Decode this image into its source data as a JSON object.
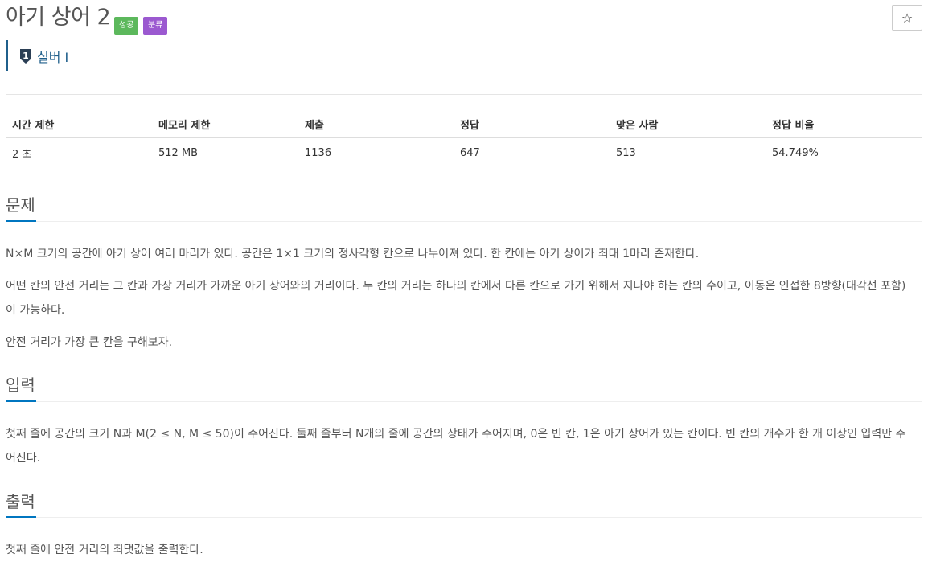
{
  "problem": {
    "title": "아기 상어 2",
    "badges": {
      "success": "성공",
      "category": "분류"
    },
    "star_icon": "☆",
    "tier": {
      "icon": "silver-tier-icon",
      "label": "실버 I"
    }
  },
  "stats": {
    "headers": [
      "시간 제한",
      "메모리 제한",
      "제출",
      "정답",
      "맞은 사람",
      "정답 비율"
    ],
    "values": [
      "2 초",
      "512 MB",
      "1136",
      "647",
      "513",
      "54.749%"
    ]
  },
  "sections": {
    "problem": {
      "title": "문제",
      "paragraphs": [
        "N×M 크기의 공간에 아기 상어 여러 마리가 있다. 공간은 1×1 크기의 정사각형 칸으로 나누어져 있다. 한 칸에는 아기 상어가 최대 1마리 존재한다.",
        "어떤 칸의 안전 거리는 그 칸과 가장 거리가 가까운 아기 상어와의 거리이다. 두 칸의 거리는 하나의 칸에서 다른 칸으로 가기 위해서 지나야 하는 칸의 수이고, 이동은 인접한 8방향(대각선 포함)이 가능하다.",
        "안전 거리가 가장 큰 칸을 구해보자."
      ]
    },
    "input": {
      "title": "입력",
      "paragraphs": [
        "첫째 줄에 공간의 크기 N과 M(2 ≤ N, M ≤ 50)이 주어진다. 둘째 줄부터 N개의 줄에 공간의 상태가 주어지며, 0은 빈 칸, 1은 아기 상어가 있는 칸이다. 빈 칸의 개수가 한 개 이상인 입력만 주어진다."
      ]
    },
    "output": {
      "title": "출력",
      "paragraphs": [
        "첫째 줄에 안전 거리의 최댓값을 출력한다."
      ]
    }
  },
  "colors": {
    "success_badge": "#5cb85c",
    "category_badge": "#9b59d0",
    "tier_text": "#1f5f8b",
    "section_accent": "#0076c0"
  }
}
